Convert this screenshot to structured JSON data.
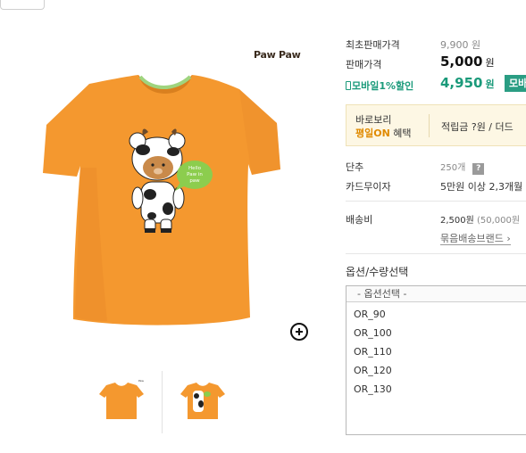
{
  "product": {
    "brand_logo": "Paw Paw",
    "shirt_text": [
      "Hello",
      "Paw in",
      "paw"
    ],
    "image_colors": {
      "shirt": "#f4982f",
      "collar_trim": "#9fd47e",
      "bubble": "#8ccd4e"
    }
  },
  "price": {
    "original_label": "최초판매가격",
    "original_value": "9,900 원",
    "sale_label": "판매가격",
    "sale_value": "5,000",
    "sale_unit": "원",
    "mobile_label": "모바일1%할인",
    "mobile_value": "4,950",
    "mobile_unit": "원",
    "mobile_button": "모바"
  },
  "promo": {
    "line1": "바로보리",
    "line2_highlight": "평일ON",
    "line2_rest": " 혜택",
    "points": "적립금 ?원 / 더드"
  },
  "details": {
    "button_label": "단추",
    "button_value": "250개",
    "help_icon": "?",
    "card_label": "카드무이자",
    "card_value": "5만원 이상 2,3개월",
    "shipping_label": "배송비",
    "shipping_value": "2,500원",
    "shipping_note": " (50,000원",
    "bundle_link": "묶음배송브랜드 ›"
  },
  "options": {
    "title": "옵션/수량선택",
    "placeholder": "- 옵션선택 -",
    "items": [
      "OR_90",
      "OR_100",
      "OR_110",
      "OR_120",
      "OR_130"
    ]
  },
  "colors": {
    "accent_green": "#2a9d83",
    "mobile_green": "#1a9a7a"
  }
}
